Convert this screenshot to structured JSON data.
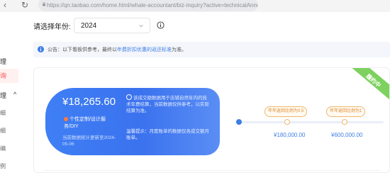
{
  "browser": {
    "back_icon": "chevron-left-icon",
    "reload_icon": "reload-icon",
    "url": "https://qn.taobao.com/home.html/whale-accountant/biz-inquiry?active=technicalAnnualFee"
  },
  "sidebar": {
    "items": [
      {
        "label": "理"
      },
      {
        "label": "询"
      },
      {
        "label": "理"
      },
      {
        "label": "^"
      },
      {
        "label": "细"
      },
      {
        "label": "细"
      },
      {
        "label": "编"
      },
      {
        "label": "例"
      }
    ]
  },
  "toolbar": {
    "year_label": "请选择年份:",
    "year_value": "2024"
  },
  "notice": {
    "prefix": "公告：以下看板供参考，最终以",
    "link": "年费折扣优惠的返还标准",
    "suffix": "为准。"
  },
  "card": {
    "ribbon": "履约中",
    "amount": "¥18,265.60",
    "tag": "个性定制/设计服务/DIY",
    "update_note": "当前数据统计更新至2024-05-06",
    "explain": "该成交额数据用于店铺自然年内的技术年费结算，当前数据仅供参考，以实际结算为准。",
    "tip": "温馨提示：月度账单的数据仅各成交额月账单。",
    "tiers": [
      {
        "label": "年年返回比例为0.5",
        "value": "¥180,000.00"
      },
      {
        "label": "年年返回比例为1",
        "value": "¥600,000.00"
      }
    ]
  },
  "colors": {
    "accent": "#3d7ee6",
    "ribbon": "#7dd15e",
    "tier_border": "#f0b66a",
    "active_menu": "#ff4d4f"
  }
}
